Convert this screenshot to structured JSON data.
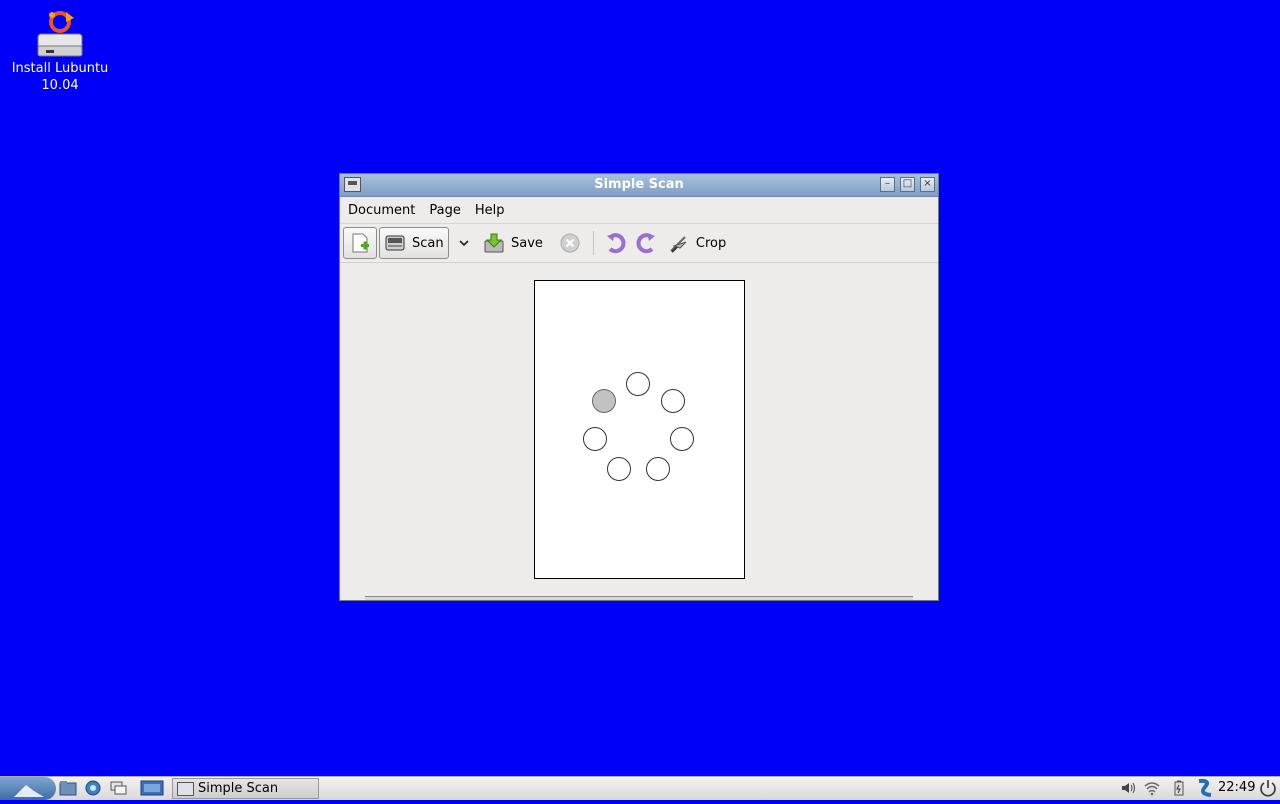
{
  "desktop": {
    "icon_label_line1": "Install Lubuntu",
    "icon_label_line2": "10.04"
  },
  "window": {
    "title": "Simple Scan",
    "menu": [
      "Document",
      "Page",
      "Help"
    ],
    "toolbar": {
      "scan_label": "Scan",
      "save_label": "Save",
      "crop_label": "Crop"
    }
  },
  "taskbar": {
    "task_label": "Simple Scan",
    "clock": "22:49"
  },
  "colors": {
    "desktop_bg": "#0000f8",
    "titlebar": "#7f9fc4"
  },
  "icons": [
    "installer-icon",
    "new-page-icon",
    "scanner-icon",
    "dropdown-icon",
    "save-icon",
    "cancel-icon",
    "rotate-left-icon",
    "rotate-right-icon",
    "crop-icon",
    "volume-icon",
    "wifi-icon",
    "battery-icon",
    "power-icon"
  ]
}
